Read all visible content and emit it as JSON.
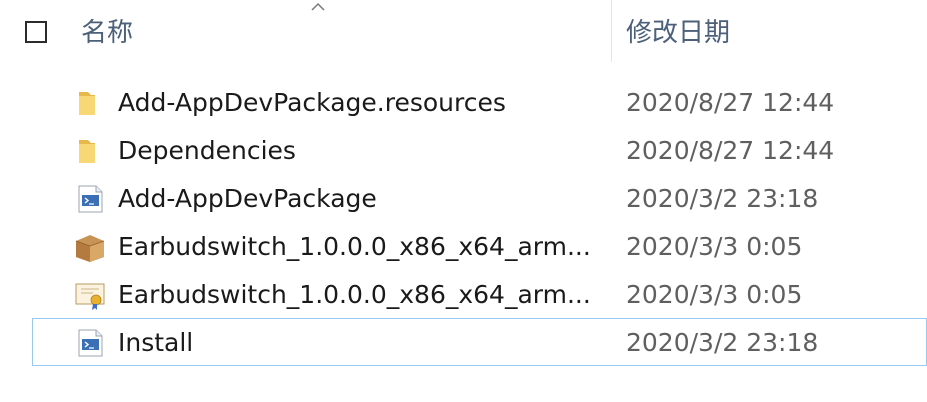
{
  "header": {
    "name_label": "名称",
    "date_label": "修改日期"
  },
  "files": [
    {
      "name": "Add-AppDevPackage.resources",
      "date": "2020/8/27 12:44",
      "icon": "folder-icon"
    },
    {
      "name": "Dependencies",
      "date": "2020/8/27 12:44",
      "icon": "folder-icon"
    },
    {
      "name": "Add-AppDevPackage",
      "date": "2020/3/2 23:18",
      "icon": "powershell-script-icon"
    },
    {
      "name": "Earbudswitch_1.0.0.0_x86_x64_arm...",
      "date": "2020/3/3 0:05",
      "icon": "package-box-icon"
    },
    {
      "name": "Earbudswitch_1.0.0.0_x86_x64_arm...",
      "date": "2020/3/3 0:05",
      "icon": "certificate-icon"
    },
    {
      "name": "Install",
      "date": "2020/3/2 23:18",
      "icon": "powershell-script-icon"
    }
  ],
  "colors": {
    "header_text": "#4c607a",
    "date_text": "#5f5f5f",
    "focus_border": "#99c9ef",
    "folder": "#f8d775"
  }
}
